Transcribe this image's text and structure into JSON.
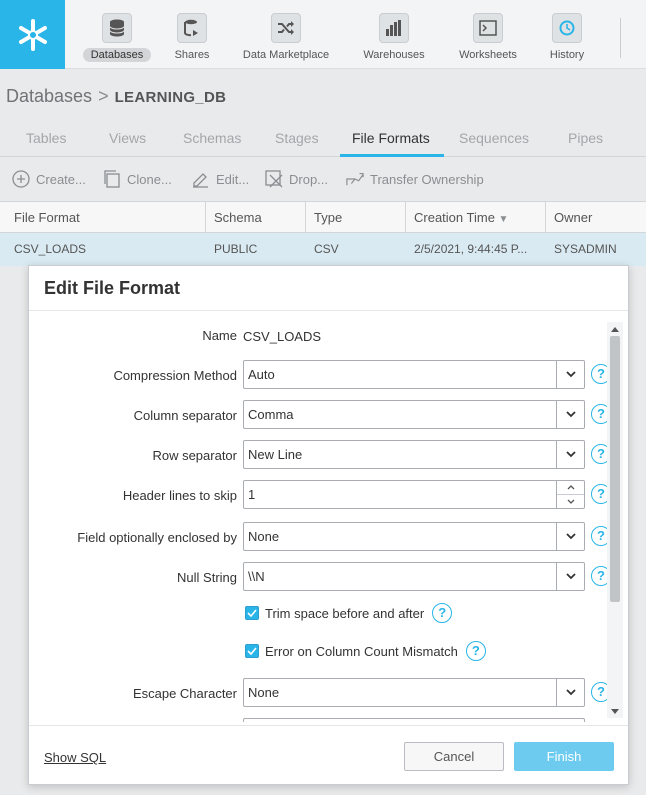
{
  "nav": {
    "items": [
      {
        "label": "Databases",
        "icon": "database-icon",
        "active": true
      },
      {
        "label": "Shares",
        "icon": "share-icon"
      },
      {
        "label": "Data Marketplace",
        "icon": "shuffle-icon"
      },
      {
        "label": "Warehouses",
        "icon": "warehouse-icon"
      },
      {
        "label": "Worksheets",
        "icon": "terminal-icon"
      },
      {
        "label": "History",
        "icon": "history-icon"
      }
    ]
  },
  "breadcrumb": {
    "root": "Databases",
    "separator": ">",
    "current": "LEARNING_DB"
  },
  "tabs": [
    "Tables",
    "Views",
    "Schemas",
    "Stages",
    "File Formats",
    "Sequences",
    "Pipes"
  ],
  "active_tab": "File Formats",
  "toolbar": {
    "create": "Create...",
    "clone": "Clone...",
    "edit": "Edit...",
    "drop": "Drop...",
    "transfer": "Transfer Ownership"
  },
  "table": {
    "headers": [
      "File Format",
      "Schema",
      "Type",
      "Creation Time",
      "Owner"
    ],
    "sort_indicator": "▼",
    "rows": [
      [
        "CSV_LOADS",
        "PUBLIC",
        "CSV",
        "2/5/2021, 9:44:45 P...",
        "SYSADMIN"
      ]
    ]
  },
  "modal": {
    "title": "Edit File Format",
    "fields": {
      "name_label": "Name",
      "name_value": "CSV_LOADS",
      "compression_label": "Compression Method",
      "compression_value": "Auto",
      "column_sep_label": "Column separator",
      "column_sep_value": "Comma",
      "row_sep_label": "Row separator",
      "row_sep_value": "New Line",
      "header_lines_label": "Header lines to skip",
      "header_lines_value": "1",
      "enclosed_label": "Field optionally enclosed by",
      "enclosed_value": "None",
      "null_label": "Null String",
      "null_value": "\\\\N",
      "trim_label": "Trim space before and after",
      "trim_checked": true,
      "error_label": "Error on Column Count Mismatch",
      "error_checked": true,
      "escape_label": "Escape Character",
      "escape_value": "None"
    },
    "help_glyph": "?",
    "show_sql": "Show SQL",
    "cancel": "Cancel",
    "finish": "Finish"
  },
  "colors": {
    "accent": "#29b5e8",
    "row_selected": "#d9eaf2",
    "finish_button": "#6ccbef"
  }
}
